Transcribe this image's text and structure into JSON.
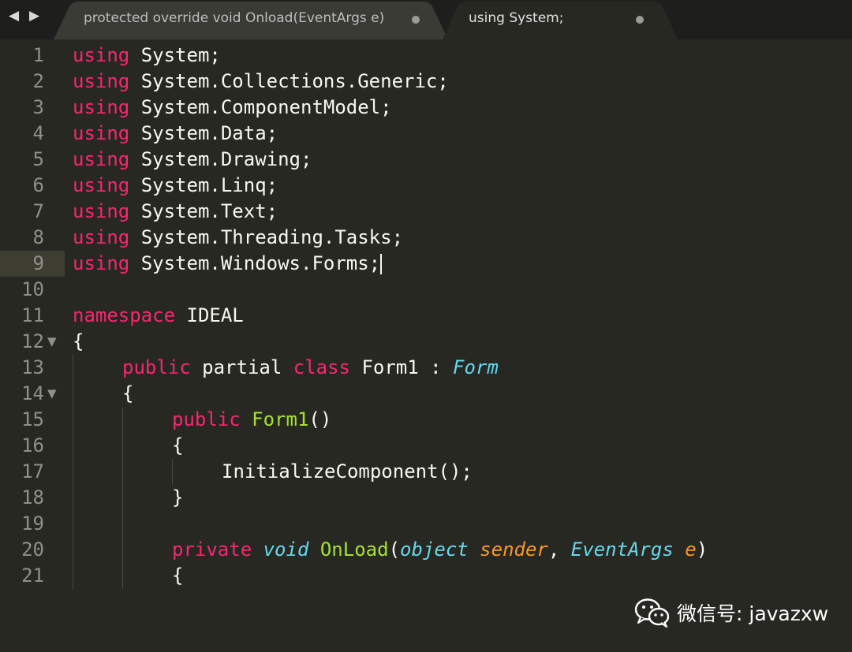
{
  "tabs": [
    {
      "label": "protected override void Onload(EventArgs e)",
      "active": false
    },
    {
      "label": "using System;",
      "active": true
    }
  ],
  "editor": {
    "lines": [
      {
        "num": "1",
        "fold": "",
        "indent": 0,
        "tokens": [
          [
            "kw",
            "using"
          ],
          [
            "plain",
            " System;"
          ]
        ]
      },
      {
        "num": "2",
        "fold": "",
        "indent": 0,
        "tokens": [
          [
            "kw",
            "using"
          ],
          [
            "plain",
            " System.Collections.Generic;"
          ]
        ]
      },
      {
        "num": "3",
        "fold": "",
        "indent": 0,
        "tokens": [
          [
            "kw",
            "using"
          ],
          [
            "plain",
            " System.ComponentModel;"
          ]
        ]
      },
      {
        "num": "4",
        "fold": "",
        "indent": 0,
        "tokens": [
          [
            "kw",
            "using"
          ],
          [
            "plain",
            " System.Data;"
          ]
        ]
      },
      {
        "num": "5",
        "fold": "",
        "indent": 0,
        "tokens": [
          [
            "kw",
            "using"
          ],
          [
            "plain",
            " System.Drawing;"
          ]
        ]
      },
      {
        "num": "6",
        "fold": "",
        "indent": 0,
        "tokens": [
          [
            "kw",
            "using"
          ],
          [
            "plain",
            " System.Linq;"
          ]
        ]
      },
      {
        "num": "7",
        "fold": "",
        "indent": 0,
        "tokens": [
          [
            "kw",
            "using"
          ],
          [
            "plain",
            " System.Text;"
          ]
        ]
      },
      {
        "num": "8",
        "fold": "",
        "indent": 0,
        "tokens": [
          [
            "kw",
            "using"
          ],
          [
            "plain",
            " System.Threading.Tasks;"
          ]
        ]
      },
      {
        "num": "9",
        "fold": "",
        "indent": 0,
        "cursor": true,
        "tokens": [
          [
            "kw",
            "using"
          ],
          [
            "plain",
            " System.Windows.Forms;"
          ]
        ]
      },
      {
        "num": "10",
        "fold": "",
        "indent": 0,
        "tokens": []
      },
      {
        "num": "11",
        "fold": "",
        "indent": 0,
        "tokens": [
          [
            "kw",
            "namespace"
          ],
          [
            "plain",
            " IDEAL"
          ]
        ]
      },
      {
        "num": "12",
        "fold": "▼",
        "indent": 0,
        "tokens": [
          [
            "plain",
            "{"
          ]
        ]
      },
      {
        "num": "13",
        "fold": "",
        "indent": 1,
        "tokens": [
          [
            "kw",
            "public"
          ],
          [
            "plain",
            " partial "
          ],
          [
            "kw",
            "class"
          ],
          [
            "plain",
            " Form1 : "
          ],
          [
            "typ",
            "Form"
          ]
        ]
      },
      {
        "num": "14",
        "fold": "▼",
        "indent": 1,
        "tokens": [
          [
            "plain",
            "{"
          ]
        ]
      },
      {
        "num": "15",
        "fold": "",
        "indent": 2,
        "tokens": [
          [
            "kw",
            "public"
          ],
          [
            "plain",
            " "
          ],
          [
            "fn",
            "Form1"
          ],
          [
            "plain",
            "()"
          ]
        ]
      },
      {
        "num": "16",
        "fold": "",
        "indent": 2,
        "tokens": [
          [
            "plain",
            "{"
          ]
        ]
      },
      {
        "num": "17",
        "fold": "",
        "indent": 3,
        "tokens": [
          [
            "plain",
            "InitializeComponent();"
          ]
        ]
      },
      {
        "num": "18",
        "fold": "",
        "indent": 2,
        "tokens": [
          [
            "plain",
            "}"
          ]
        ]
      },
      {
        "num": "19",
        "fold": "",
        "indent": 0,
        "tokens": []
      },
      {
        "num": "20",
        "fold": "",
        "indent": 2,
        "tokens": [
          [
            "kw",
            "private"
          ],
          [
            "plain",
            " "
          ],
          [
            "typ",
            "void"
          ],
          [
            "plain",
            " "
          ],
          [
            "fn",
            "OnLoad"
          ],
          [
            "plain",
            "("
          ],
          [
            "typ",
            "object"
          ],
          [
            "plain",
            " "
          ],
          [
            "param",
            "sender"
          ],
          [
            "plain",
            ", "
          ],
          [
            "typ",
            "EventArgs"
          ],
          [
            "plain",
            " "
          ],
          [
            "param",
            "e"
          ],
          [
            "plain",
            ")"
          ]
        ]
      },
      {
        "num": "21",
        "fold": "",
        "indent": 2,
        "tokens": [
          [
            "plain",
            "{"
          ]
        ]
      }
    ]
  },
  "watermark": {
    "text": "微信号: javazxw",
    "icon": "wechat-icon"
  },
  "colors": {
    "background": "#272822",
    "keyword": "#f92672",
    "type": "#66d9ef",
    "function": "#a6e22e",
    "parameter": "#fd971f",
    "text": "#f8f8f2",
    "line_number": "#8f908a"
  }
}
